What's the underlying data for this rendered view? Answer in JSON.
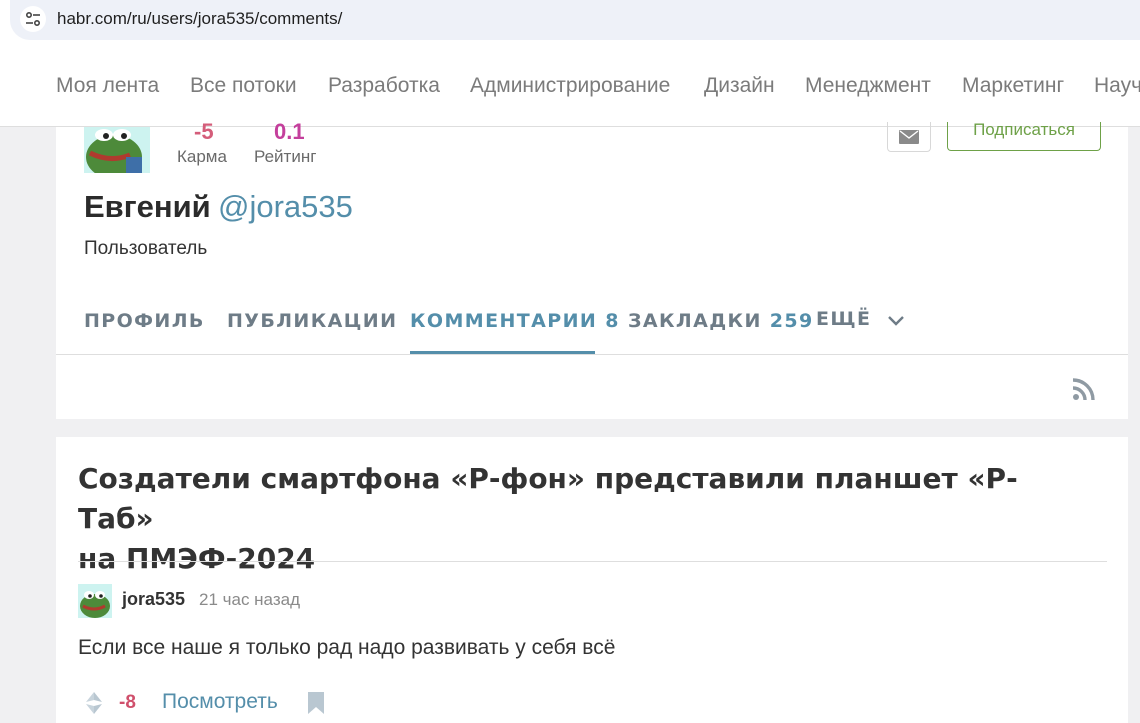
{
  "browser": {
    "url": "habr.com/ru/users/jora535/comments/"
  },
  "nav": {
    "items": [
      "Моя лента",
      "Все потоки",
      "Разработка",
      "Администрирование",
      "Дизайн",
      "Менеджмент",
      "Маркетинг",
      "Научпоп"
    ]
  },
  "profile": {
    "karma_value": "-5",
    "rating_value": "0.1",
    "karma_label": "Карма",
    "rating_label": "Рейтинг",
    "subscribe_label": "Подписаться",
    "name": "Евгений",
    "handle": "@jora535",
    "role": "Пользователь",
    "tabs": [
      {
        "label": "ПРОФИЛЬ",
        "count": ""
      },
      {
        "label": "ПУБЛИКАЦИИ",
        "count": ""
      },
      {
        "label": "КОММЕНТАРИИ",
        "count": "8"
      },
      {
        "label": "ЗАКЛАДКИ",
        "count": "259"
      },
      {
        "label": "ЕЩЁ",
        "count": ""
      }
    ]
  },
  "comment": {
    "post_title_line1": "Создатели смартфона «Р-фон» представили планшет «Р-Таб»",
    "post_title_line2": "на ПМЭФ-2024",
    "author": "jora535",
    "time": "21 час назад",
    "text": "Если все наше я только рад надо развивать у себя всё",
    "score": "-8",
    "view_label": "Посмотреть"
  },
  "colors": {
    "accent": "#548eaa",
    "negative": "#d0506c",
    "subscribe": "#6ea148"
  }
}
